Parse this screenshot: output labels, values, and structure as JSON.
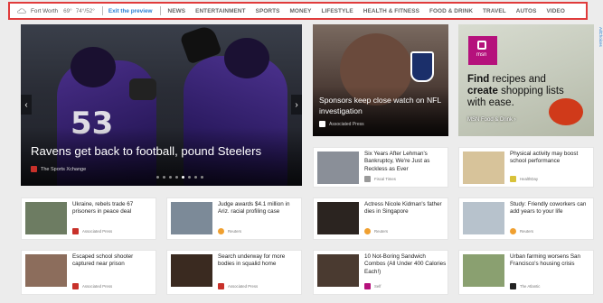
{
  "nav": {
    "weather": {
      "city": "Fort Worth",
      "current": "69°",
      "range": "74°/52°"
    },
    "exit_preview": "Exit the preview",
    "items": [
      "NEWS",
      "ENTERTAINMENT",
      "SPORTS",
      "MONEY",
      "LIFESTYLE",
      "HEALTH & FITNESS",
      "FOOD & DRINK",
      "TRAVEL",
      "AUTOS",
      "VIDEO"
    ]
  },
  "hero": {
    "title": "Ravens get back to football, pound Steelers",
    "source": "The Sports Xchange",
    "jersey_left": "53"
  },
  "sponsor_card": {
    "title": "Sponsors keep close watch on NFL investigation",
    "source": "Associated Press"
  },
  "ad": {
    "logo_text": "msn",
    "headline_part1": "Find",
    "headline_part2": " recipes and ",
    "headline_part3": "create",
    "headline_part4": " shopping lists with ease.",
    "caption": "MSN Food & Drink ›",
    "adchoices": "AdChoices"
  },
  "cards": [
    {
      "title": "Six Years After Lehman's Bankruptcy, We're Just as Reckless as Ever",
      "source": "Fiscal Times",
      "color": "#8a8f98"
    },
    {
      "title": "Physical activity may boost school performance",
      "source": "HealthDay",
      "color": "#d7c39a"
    },
    {
      "title": "Ukraine, rebels trade 67 prisoners in peace deal",
      "source": "Associated Press",
      "color": "#6d7c62"
    },
    {
      "title": "Judge awards $4.1 million in Ariz. racial profiling case",
      "source": "Reuters",
      "color": "#7c8a98"
    },
    {
      "title": "Actress Nicole Kidman's father dies in Singapore",
      "source": "Reuters",
      "color": "#2b2420"
    },
    {
      "title": "Study: Friendly coworkers can add years to your life",
      "source": "Reuters",
      "color": "#b7c2cc"
    },
    {
      "title": "Escaped school shooter captured near prison",
      "source": "Associated Press",
      "color": "#8c6d5c"
    },
    {
      "title": "Search underway for more bodies in squalid home",
      "source": "Associated Press",
      "color": "#3a2a20"
    },
    {
      "title": "10 Not-Boring Sandwich Combos (All Under 400 Calories Each!)",
      "source": "Self",
      "color": "#4a3a30"
    },
    {
      "title": "Urban farming worsens San Francisco's housing crisis",
      "source": "The Atlantic",
      "color": "#8aa070"
    }
  ]
}
